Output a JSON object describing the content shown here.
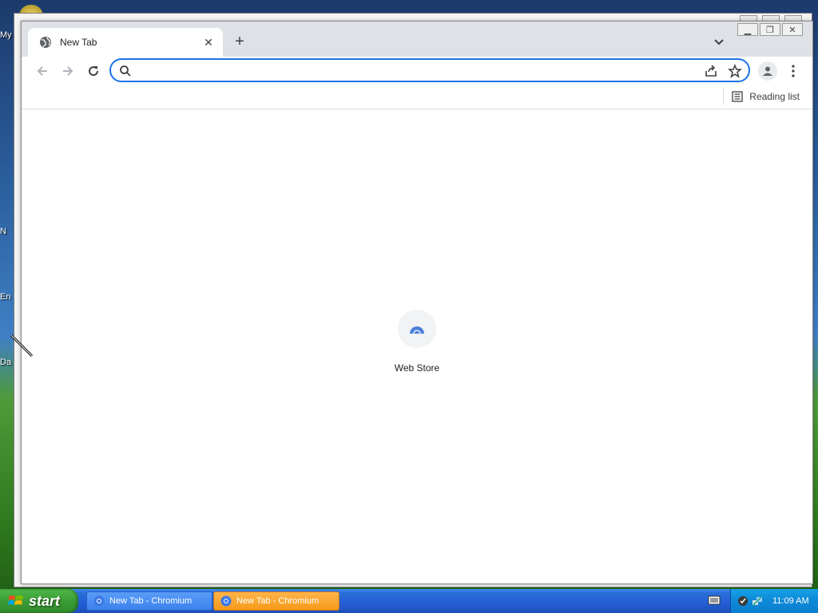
{
  "desktop": {
    "labels": [
      "My",
      "N",
      "En",
      "Da"
    ]
  },
  "browser": {
    "tab": {
      "title": "New Tab",
      "favicon": "globe-icon"
    },
    "new_tab_symbol": "+",
    "window_controls": {
      "minimize": "minimize-icon",
      "restore": "restore-icon",
      "close": "close-icon"
    },
    "omnibox": {
      "value": "",
      "placeholder": ""
    },
    "bookmarks_bar": {
      "reading_list_label": "Reading list"
    },
    "shortcuts": [
      {
        "label": "Web Store",
        "icon": "web-store-icon"
      }
    ]
  },
  "taskbar": {
    "start_label": "start",
    "tasks": [
      {
        "label": "New Tab - Chromium",
        "active": false
      },
      {
        "label": "New Tab - Chromium",
        "active": true
      }
    ],
    "clock": "11:09 AM"
  },
  "colors": {
    "accent": "#1a73e8",
    "tabstrip": "#dee1e6",
    "taskbar": "#245ed6",
    "start": "#3a9d35",
    "active_task": "#f59a1a"
  }
}
